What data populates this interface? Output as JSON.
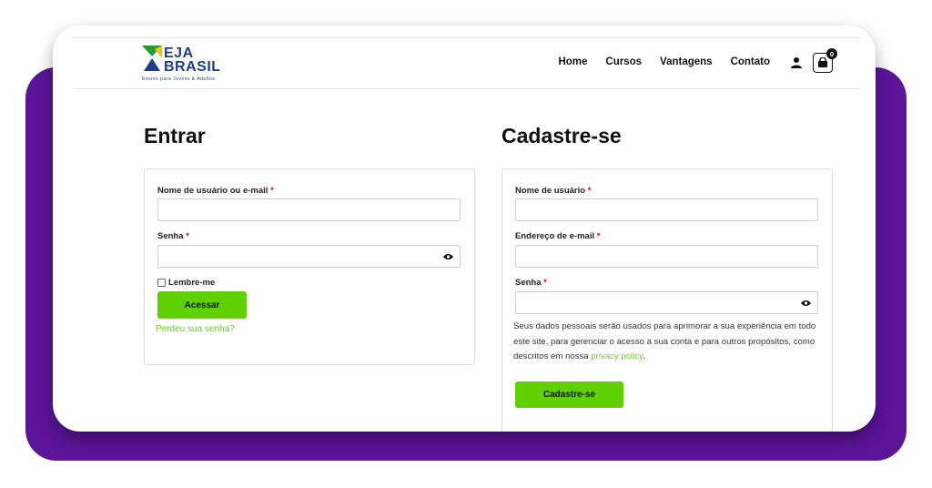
{
  "brand": {
    "line1": "EJA",
    "line2": "BRASIL",
    "tagline": "Ensino para Jovens & Adultos"
  },
  "nav": {
    "items": [
      "Home",
      "Cursos",
      "Vantagens",
      "Contato"
    ],
    "cart_count": "0"
  },
  "login": {
    "title": "Entrar",
    "username_label": "Nome de usuário ou e-mail",
    "password_label": "Senha",
    "required_mark": "*",
    "remember_label": "Lembre-me",
    "submit_label": "Acessar",
    "lost_password": "Perdeu sua senha?"
  },
  "register": {
    "title": "Cadastre-se",
    "username_label": "Nome de usuário",
    "email_label": "Endereço de e-mail",
    "password_label": "Senha",
    "required_mark": "*",
    "privacy_text": "Seus dados pessoais serão usados para aprimorar a sua experiência em todo este site, para gerenciar o acesso a sua conta e para outros propósitos, como descritos em nossa",
    "privacy_link": "privacy policy",
    "privacy_end": ".",
    "submit_label": "Cadastre-se"
  },
  "colors": {
    "purple": "#5c1499",
    "green_button": "#5fd000",
    "green_link": "#6acb28",
    "brand_blue": "#1b3d8f",
    "brand_green": "#1f9b3a",
    "brand_yellow": "#f5c400"
  }
}
